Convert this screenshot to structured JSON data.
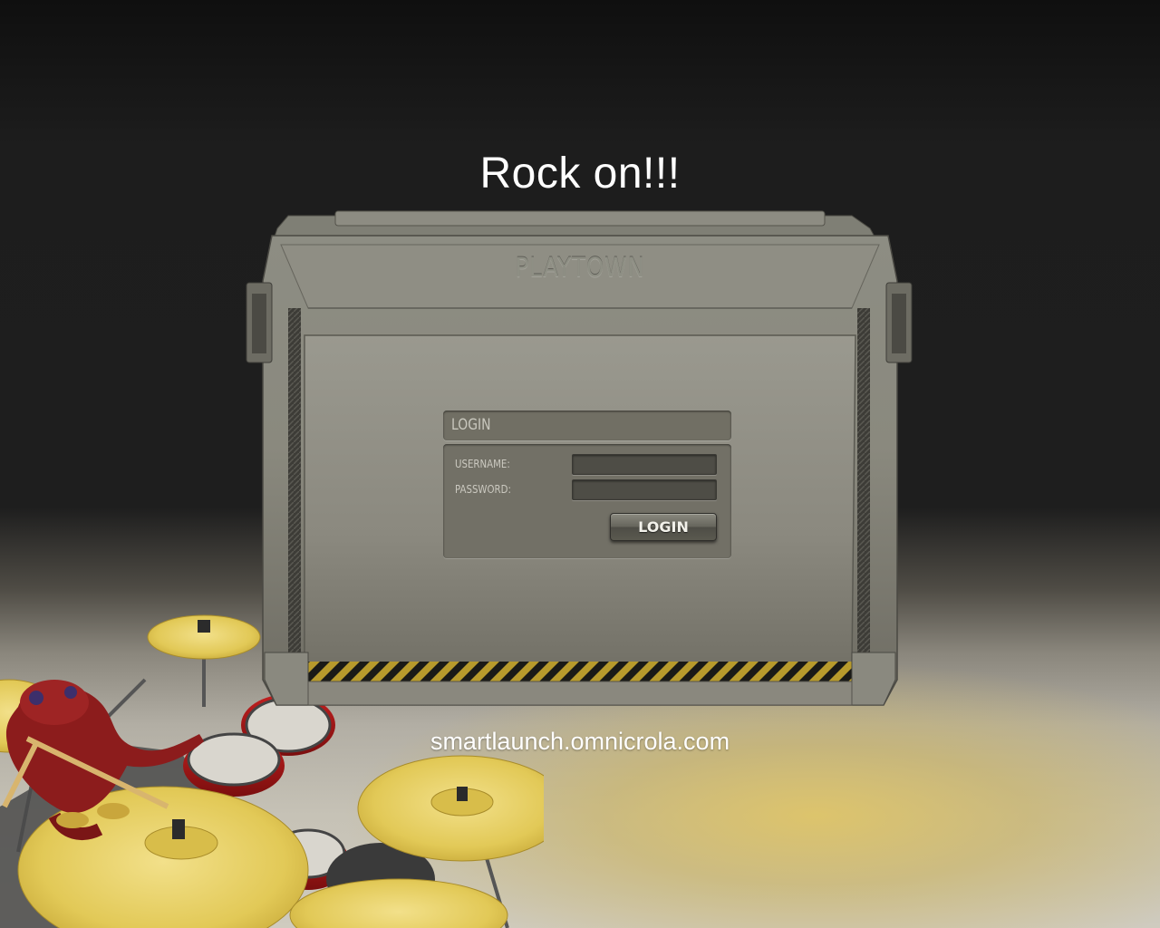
{
  "headline": "Rock on!!!",
  "brand": "PLAYTOWN",
  "login": {
    "title": "LOGIN",
    "username_label": "USERNAME:",
    "password_label": "PASSWORD:",
    "username_value": "",
    "password_value": "",
    "button_label": "LOGIN"
  },
  "footer_url": "smartlaunch.omnicrola.com",
  "colors": {
    "background_top": "#151515",
    "floor": "#c6c2b6",
    "spotlight": "#dcc468",
    "box_metal": "#8f8e82",
    "panel": "#727066",
    "hazard_yellow": "#b79a2c",
    "cymbal": "#e2cc5a",
    "drum_red": "#a01818",
    "creature": "#8c1c1c"
  },
  "icons": [
    "hazard-stripe",
    "side-handle",
    "drummer-creature",
    "cymbal",
    "drum"
  ]
}
